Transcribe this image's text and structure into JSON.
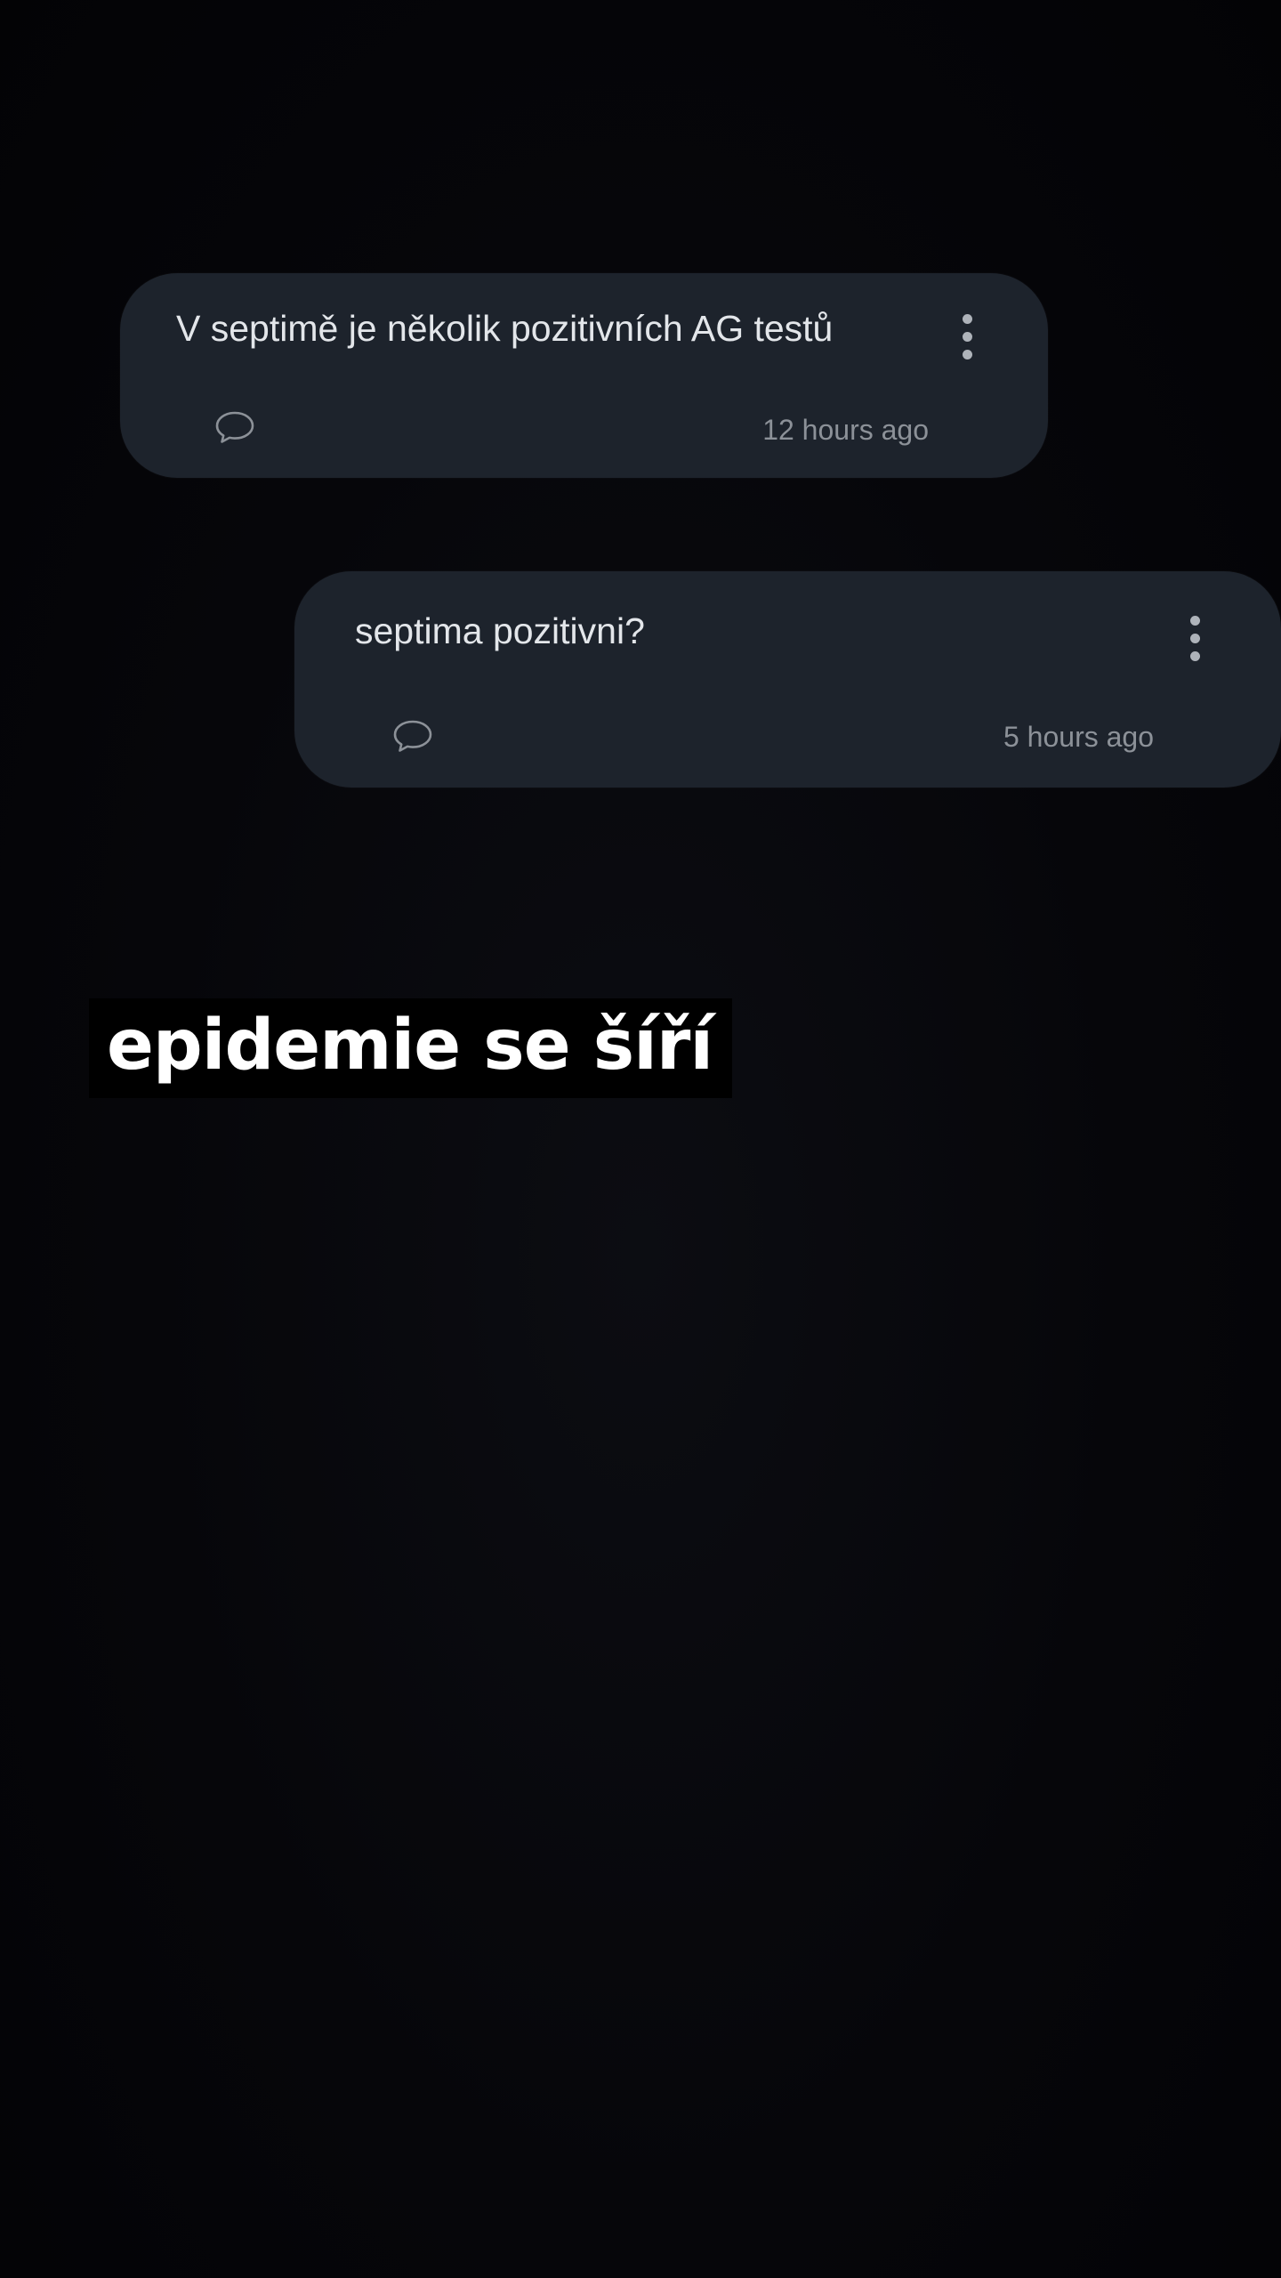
{
  "posts": [
    {
      "text": "V septimě je několik pozitivních AG testů",
      "timestamp": "12 hours ago",
      "comment_icon": "comment-bubble-icon",
      "menu_icon": "more-vertical-icon"
    },
    {
      "text": "septima pozitivni?",
      "timestamp": "5 hours ago",
      "comment_icon": "comment-bubble-icon",
      "menu_icon": "more-vertical-icon"
    }
  ],
  "caption": "epidemie se šíří",
  "colors": {
    "background": "#050507",
    "card": "#1d232c",
    "text": "#e3e6ea",
    "muted": "#8c9198",
    "caption_bg": "#000000",
    "caption_text": "#ffffff"
  }
}
